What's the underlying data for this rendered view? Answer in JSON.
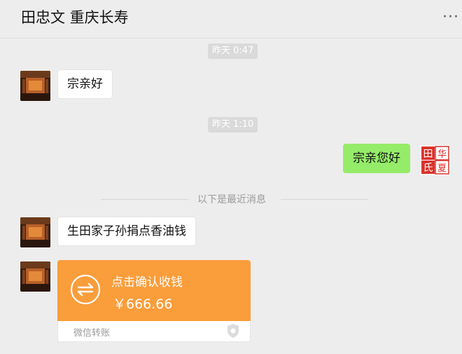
{
  "header": {
    "title": "田忠文 重庆长寿",
    "more_label": "···",
    "more_icon": "more-dots-icon"
  },
  "colors": {
    "background": "#ededed",
    "my_bubble": "#95ec69",
    "transfer": "#fa9d3b",
    "seal_red": "#d9322b"
  },
  "messages": [
    {
      "type": "timestamp",
      "text": "昨天 0:47"
    },
    {
      "type": "text",
      "from": "other",
      "text": "宗亲好"
    },
    {
      "type": "timestamp",
      "text": "昨天 1:10"
    },
    {
      "type": "text",
      "from": "me",
      "text": "宗亲您好"
    },
    {
      "type": "divider",
      "text": "以下是最近消息"
    },
    {
      "type": "text",
      "from": "other",
      "text": "生田家子孙捐点香油钱"
    },
    {
      "type": "transfer",
      "from": "other",
      "label": "点击确认收钱",
      "amount": "￥666.66",
      "brand": "微信转账",
      "icon": "transfer-arrows-icon"
    }
  ],
  "seal": {
    "chars": [
      "田",
      "华",
      "氏",
      "夏"
    ]
  }
}
